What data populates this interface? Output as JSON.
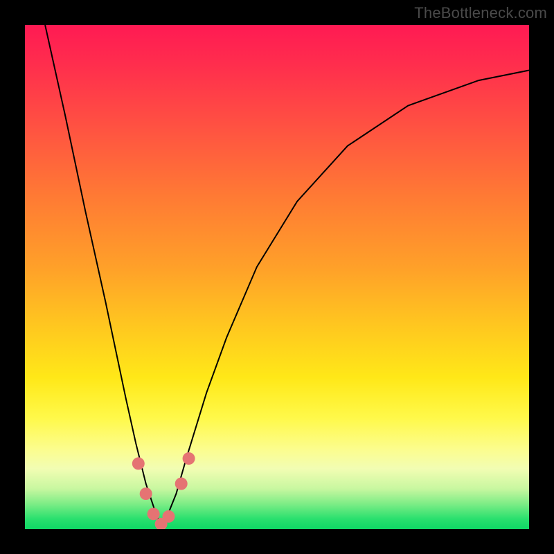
{
  "watermark": "TheBottleneck.com",
  "chart_data": {
    "type": "line",
    "title": "",
    "xlabel": "",
    "ylabel": "",
    "xlim": [
      0,
      100
    ],
    "ylim": [
      0,
      100
    ],
    "grid": false,
    "background_gradient": {
      "top": "#ff1a53",
      "middle": "#ffe818",
      "bottom": "#0fd865",
      "description": "Vertical gradient red→orange→yellow→green representing bottleneck severity (red high, green low)"
    },
    "series": [
      {
        "name": "bottleneck-curve",
        "description": "V-shaped curve; y is bottleneck severity (~100 = worst, ~0 = optimal) as a function of configuration x. Minimum near x≈27 at y≈0.",
        "x": [
          4,
          8,
          12,
          16,
          20,
          22,
          24,
          26,
          27,
          28,
          30,
          32,
          36,
          40,
          46,
          54,
          64,
          76,
          90,
          100
        ],
        "y": [
          100,
          82,
          63,
          45,
          26,
          17,
          9,
          3,
          0.5,
          2,
          7,
          14,
          27,
          38,
          52,
          65,
          76,
          84,
          89,
          91
        ]
      }
    ],
    "markers": {
      "description": "Pink dots clustered around the curve minimum",
      "points": [
        {
          "x": 22.5,
          "y": 13
        },
        {
          "x": 24.0,
          "y": 7
        },
        {
          "x": 25.5,
          "y": 3
        },
        {
          "x": 27.0,
          "y": 1
        },
        {
          "x": 28.5,
          "y": 2.5
        },
        {
          "x": 31.0,
          "y": 9
        },
        {
          "x": 32.5,
          "y": 14
        }
      ],
      "color": "#e57373",
      "radius_px": 9
    }
  }
}
